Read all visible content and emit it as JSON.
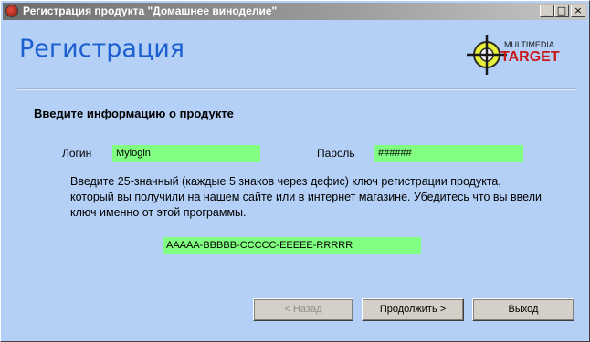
{
  "window": {
    "title": "Регистрация продукта \"Домашнее виноделие\""
  },
  "titlebar": {
    "minimize": "_",
    "maximize": "□",
    "close": "×"
  },
  "header": {
    "heading": "Регистрация",
    "logo": {
      "top": "MULTIMEDIA",
      "main": "TARGET"
    }
  },
  "section_title": "Введите информацию о продукте",
  "form": {
    "login_label": "Логин",
    "login_value": "Mylogin",
    "password_label": "Пароль",
    "password_value": "######",
    "description": "Введите 25-значный (каждые 5 знаков через дефис) ключ регистрации продукта, который вы получили на нашем сайте или в интернет магазине. Убедитесь что вы ввели ключ именно от этой программы.",
    "key_value": "AAAAA-BBBBB-CCCCC-EEEEE-RRRRR"
  },
  "buttons": {
    "back": "< Назад",
    "next": "Продолжить >",
    "exit": "Выход"
  },
  "colors": {
    "background": "#b4d0f7",
    "field": "#80ff80",
    "heading": "#1b5fd0"
  }
}
